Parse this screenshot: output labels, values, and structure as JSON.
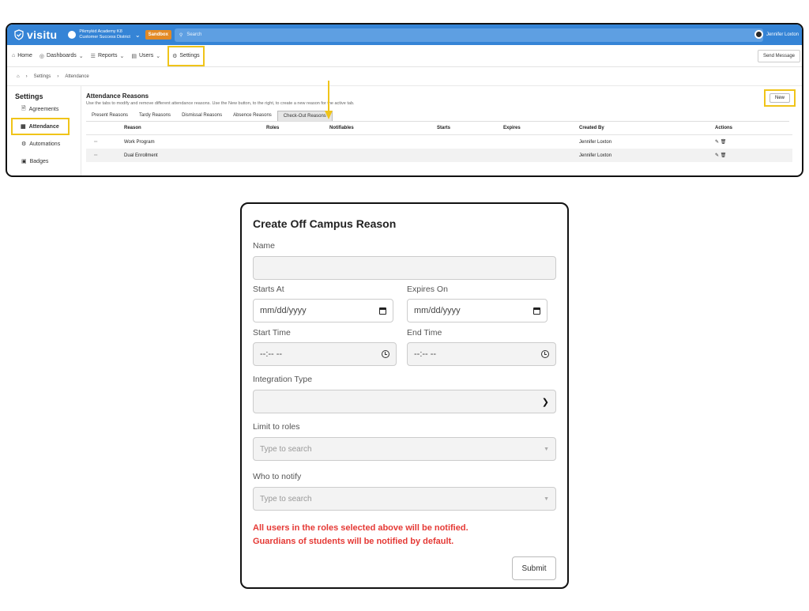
{
  "app": {
    "logo": "visitu",
    "org_name": "Pikmykid Academy K8",
    "org_district": "Customer Success District",
    "sandbox_label": "Sandbox",
    "search_placeholder": "Search",
    "user_name": "Jennifer Loxton",
    "accent_color": "#3584d6",
    "highlight_color": "#f0c419"
  },
  "nav": {
    "items": [
      {
        "label": "Home",
        "icon": "home-icon"
      },
      {
        "label": "Dashboards",
        "icon": "dashboard-icon"
      },
      {
        "label": "Reports",
        "icon": "reports-icon"
      },
      {
        "label": "Users",
        "icon": "users-icon"
      },
      {
        "label": "Settings",
        "icon": "gear-icon"
      }
    ],
    "send_message": "Send Message"
  },
  "breadcrumb": {
    "settings": "Settings",
    "current": "Attendance"
  },
  "sidebar": {
    "title": "Settings",
    "items": [
      {
        "label": "Agreements",
        "icon": "agreements-icon"
      },
      {
        "label": "Attendance",
        "icon": "attendance-icon"
      },
      {
        "label": "Automations",
        "icon": "automations-icon"
      },
      {
        "label": "Badges",
        "icon": "badges-icon"
      }
    ]
  },
  "main": {
    "title": "Attendance Reasons",
    "description": "Use the tabs to modify and remove different attendance reasons. Use the New button, to the right, to create a new reason for the active tab.",
    "new_button": "New",
    "tabs": [
      "Present Reasons",
      "Tardy Reasons",
      "Dismissal Reasons",
      "Absence Reasons",
      "Check-Out Reasons"
    ],
    "active_tab": "Check-Out Reasons",
    "columns": [
      "Reason",
      "Roles",
      "Notifiables",
      "Starts",
      "Expires",
      "Created By",
      "Actions"
    ],
    "rows": [
      {
        "reason": "Work Program",
        "roles": "",
        "notifiables": "",
        "starts": "",
        "expires": "",
        "created_by": "Jennifer Loxton"
      },
      {
        "reason": "Dual Enrollment",
        "roles": "",
        "notifiables": "",
        "starts": "",
        "expires": "",
        "created_by": "Jennifer Loxton"
      }
    ]
  },
  "modal": {
    "title": "Create Off Campus Reason",
    "name_label": "Name",
    "name_value": "",
    "starts_at_label": "Starts At",
    "starts_at_value": "mm/dd/yyyy",
    "expires_on_label": "Expires On",
    "expires_on_value": "mm/dd/yyyy",
    "start_time_label": "Start Time",
    "start_time_value": "--:-- --",
    "end_time_label": "End Time",
    "end_time_value": "--:-- --",
    "integration_label": "Integration Type",
    "integration_value": "",
    "limit_roles_label": "Limit to roles",
    "limit_roles_placeholder": "Type to search",
    "notify_label": "Who to notify",
    "notify_placeholder": "Type to search",
    "notice_line1": "All users in the roles selected above will be notified.",
    "notice_line2": "Guardians of students will be notified by default.",
    "submit": "Submit",
    "notice_color": "#e53935"
  }
}
